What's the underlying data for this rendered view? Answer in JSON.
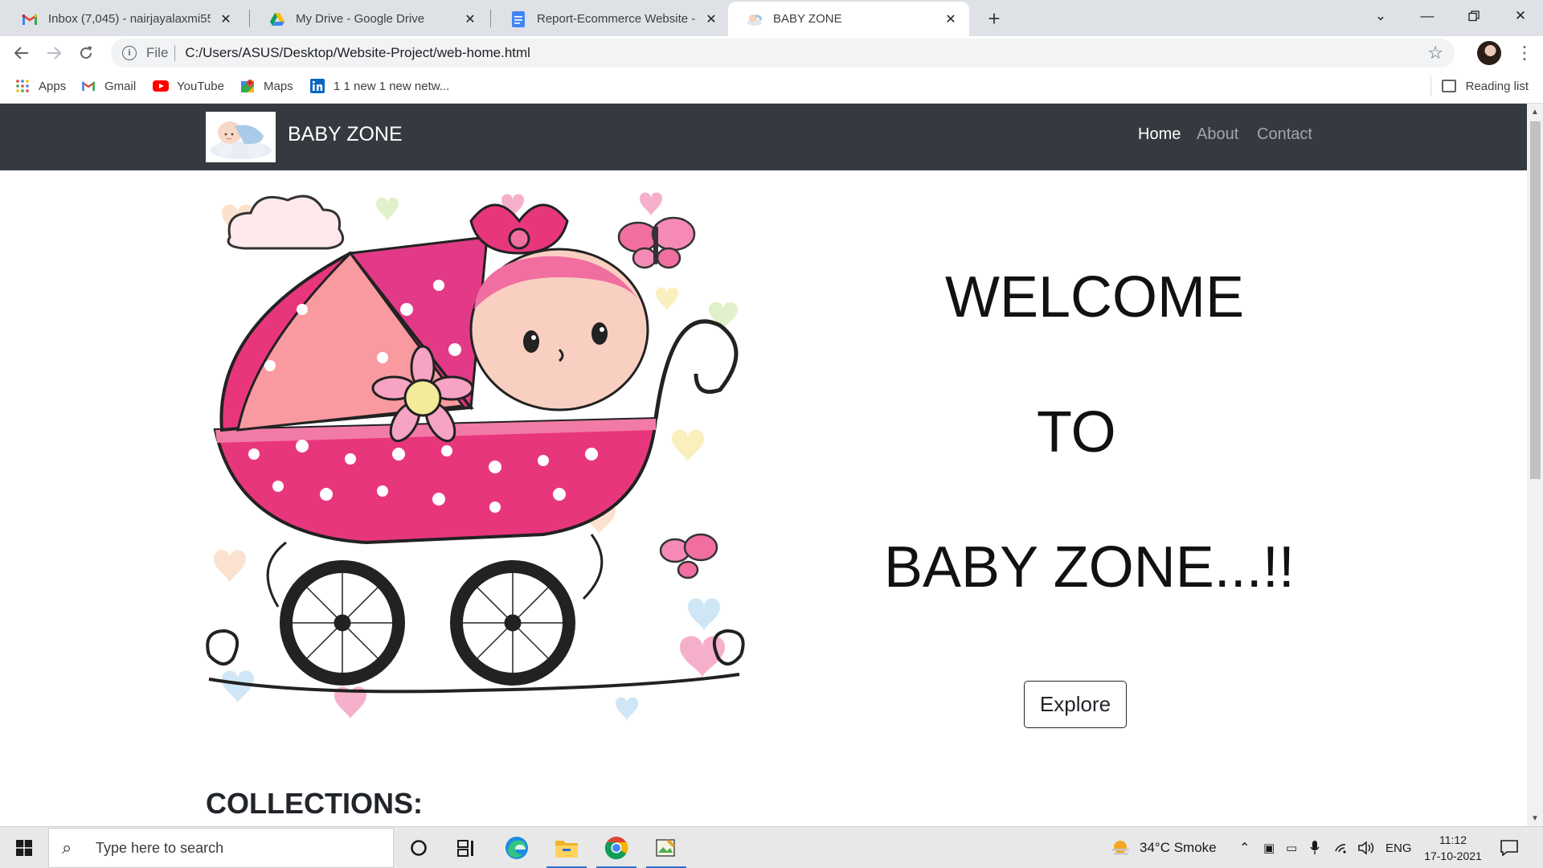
{
  "browser": {
    "tabs": [
      {
        "title": "Inbox (7,045) - nairjayalaxmi55@",
        "icon": "gmail-icon",
        "active": false
      },
      {
        "title": "My Drive - Google Drive",
        "icon": "google-drive-icon",
        "active": false
      },
      {
        "title": "Report-Ecommerce Website - Go",
        "icon": "google-docs-icon",
        "active": false
      },
      {
        "title": "BABY ZONE",
        "icon": "baby-favicon",
        "active": true
      }
    ],
    "address": {
      "scheme_label": "File",
      "url": "C:/Users/ASUS/Desktop/Website-Project/web-home.html"
    },
    "bookmarks": [
      {
        "label": "Apps",
        "icon": "apps-grid-icon"
      },
      {
        "label": "Gmail",
        "icon": "gmail-icon"
      },
      {
        "label": "YouTube",
        "icon": "youtube-icon"
      },
      {
        "label": "Maps",
        "icon": "maps-icon"
      },
      {
        "label": "1 1 new 1 new netw...",
        "icon": "linkedin-icon"
      }
    ],
    "reading_list": "Reading list"
  },
  "page": {
    "brand": "BABY ZONE",
    "nav": [
      {
        "label": "Home",
        "active": true
      },
      {
        "label": "About",
        "active": false
      },
      {
        "label": "Contact",
        "active": false
      }
    ],
    "welcome": {
      "line1": "WELCOME",
      "line2": "TO",
      "line3": "BABY ZONE...!!"
    },
    "explore_button": "Explore",
    "collections_heading": "COLLECTIONS:",
    "colors": {
      "navbar": "#343a40",
      "pink": "#e8367d"
    }
  },
  "taskbar": {
    "search_placeholder": "Type here to search",
    "weather": "34°C  Smoke",
    "language": "ENG",
    "time": "11:12",
    "date": "17-10-2021"
  }
}
